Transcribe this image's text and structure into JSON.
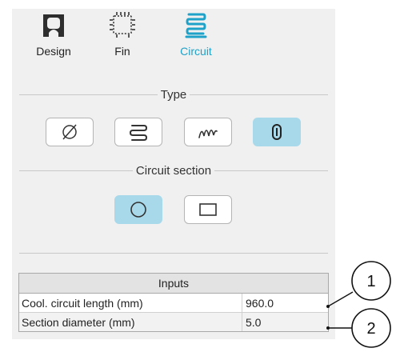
{
  "tabs": [
    {
      "label": "Design",
      "icon": "design-icon"
    },
    {
      "label": "Fin",
      "icon": "fin-icon"
    },
    {
      "label": "Circuit",
      "icon": "circuit-icon",
      "active": true
    }
  ],
  "type_section": {
    "title": "Type",
    "options": [
      {
        "icon": "none-icon",
        "selected": false
      },
      {
        "icon": "serpentine-icon",
        "selected": false
      },
      {
        "icon": "wave-icon",
        "selected": false
      },
      {
        "icon": "tube-icon",
        "selected": true
      }
    ]
  },
  "circuit_section": {
    "title": "Circuit section",
    "options": [
      {
        "icon": "circle-section-icon",
        "selected": true
      },
      {
        "icon": "rectangle-section-icon",
        "selected": false
      }
    ]
  },
  "inputs": {
    "header": "Inputs",
    "rows": [
      {
        "label": "Cool. circuit length (mm)",
        "value": "960.0"
      },
      {
        "label": "Section diameter (mm)",
        "value": "5.0"
      }
    ]
  },
  "callouts": [
    "1",
    "2"
  ],
  "colors": {
    "accent": "#1fa2c9",
    "selected_bg": "#a8d9ea",
    "panel_bg": "#f0f0f0"
  }
}
